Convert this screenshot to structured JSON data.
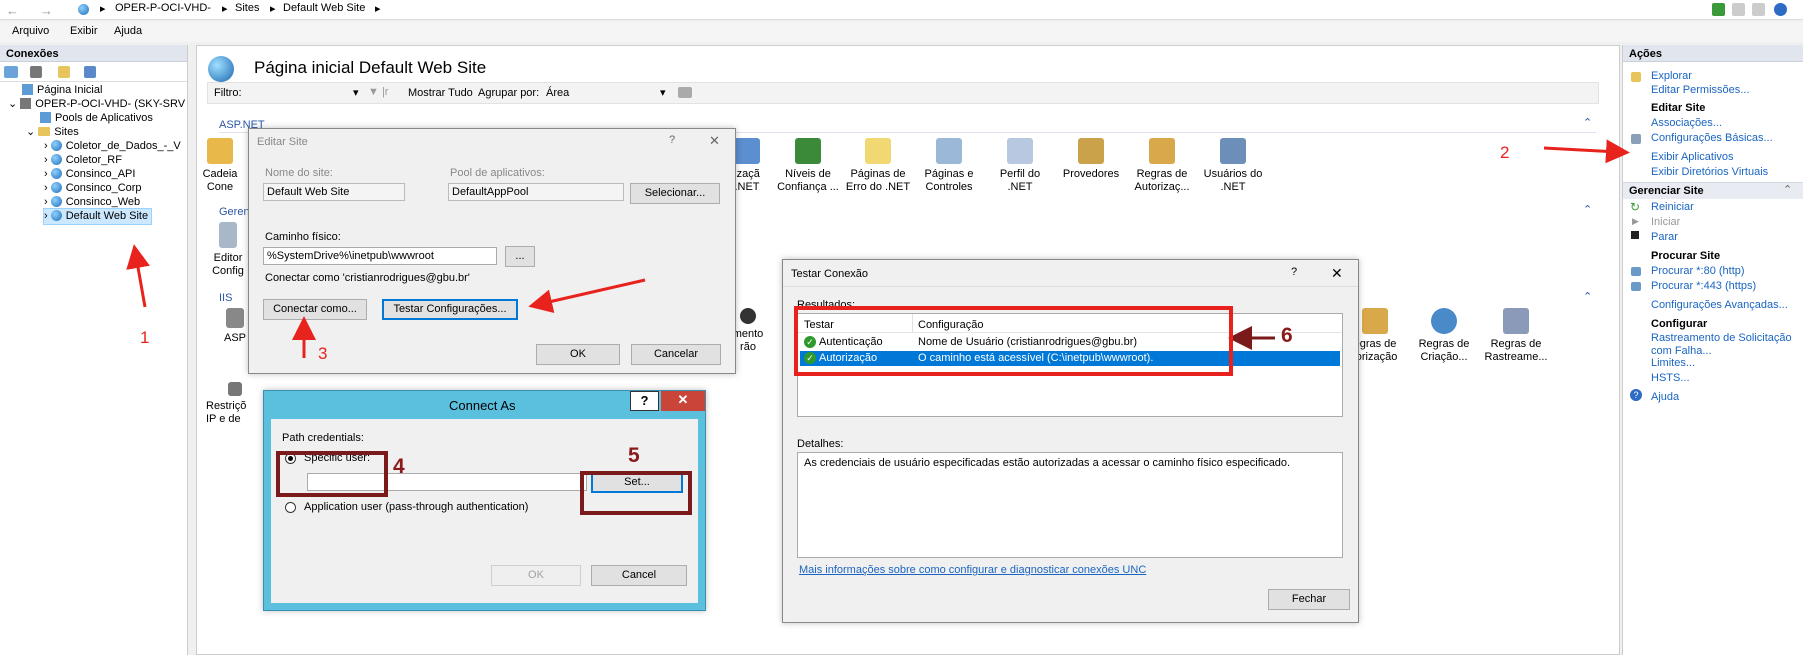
{
  "address": {
    "crumbs": [
      "OPER-P-OCI-VHD-",
      "Sites",
      "Default Web Site"
    ]
  },
  "menu": [
    "Arquivo",
    "Exibir",
    "Ajuda"
  ],
  "connections": {
    "header": "Conexões",
    "tree": [
      "Página Inicial",
      "OPER-P-OCI-VHD- (SKY-SRV",
      "Pools de Aplicativos",
      "Sites",
      "Coletor_de_Dados_-_V",
      "Coletor_RF",
      "Consinco_API",
      "Consinco_Corp",
      "Consinco_Web",
      "Default Web Site"
    ]
  },
  "main": {
    "title": "Página inicial Default Web Site",
    "filter_label": "Filtro:",
    "show_all": "Mostrar Tudo",
    "group_by_label": "Agrupar por:",
    "group_by_value": "Área",
    "groups": {
      "aspnet": "ASP.NET",
      "gerenc": "Gerenc",
      "iis": "IIS"
    },
    "aspnet_icons": [
      "Cadeia\nCone",
      "izaçã\n.NET",
      "Níveis de\nConfiança ...",
      "Páginas de\nErro do .NET",
      "Páginas e\nControles",
      "Perfil do\n.NET",
      "Provedores",
      "Regras de\nAutorizaç...",
      "Usuários do\n.NET"
    ],
    "gerenc_icons": [
      "Editor\nConfig"
    ],
    "iis_icons": [
      "ASP",
      "mento\nrão",
      "egras de\ntorização",
      "Regras de\nCriação...",
      "Regras de\nRastreame..."
    ],
    "iis_icons_row2": [
      "Restriçõ\nIP e de"
    ]
  },
  "edit_site": {
    "title": "Editar Site",
    "help": "?",
    "close": "✕",
    "site_name_label": "Nome do site:",
    "site_name": "Default Web Site",
    "pool_label": "Pool de aplicativos:",
    "pool": "DefaultAppPool",
    "select_btn": "Selecionar...",
    "path_label": "Caminho físico:",
    "path": "%SystemDrive%\\inetpub\\wwwroot",
    "browse_btn": "...",
    "connect_as_text": "Conectar como 'cristianrodrigues@gbu.br'",
    "connect_btn": "Conectar como...",
    "test_btn": "Testar Configurações...",
    "ok": "OK",
    "cancel": "Cancelar"
  },
  "connect_as": {
    "title": "Connect As",
    "help": "?",
    "close": "✕",
    "path_credentials": "Path credentials:",
    "specific_user": "Specific user:",
    "set_btn": "Set...",
    "app_user": "Application user (pass-through authentication)",
    "ok": "OK",
    "cancel": "Cancel"
  },
  "test_conn": {
    "title": "Testar Conexão",
    "help": "?",
    "close": "✕",
    "results_label": "Resultados:",
    "col_test": "Testar",
    "col_config": "Configuração",
    "rows": [
      {
        "test": "Autenticação",
        "config": "Nome de Usuário (cristianrodrigues@gbu.br)"
      },
      {
        "test": "Autorização",
        "config": "O caminho está acessível (C:\\inetpub\\wwwroot)."
      }
    ],
    "details_label": "Detalhes:",
    "details": "As credenciais de usuário especificadas estão autorizadas a acessar o caminho físico especificado.",
    "link": "Mais informações sobre como configurar e diagnosticar conexões UNC",
    "close_btn": "Fechar"
  },
  "actions": {
    "header": "Ações",
    "explorar": "Explorar",
    "editar_permissoes": "Editar Permissões...",
    "editar_site": "Editar Site",
    "associacoes": "Associações...",
    "config_basicas": "Configurações Básicas...",
    "exibir_aplicativos": "Exibir Aplicativos",
    "exibir_diretorios": "Exibir Diretórios Virtuais",
    "gerenciar_site": "Gerenciar Site",
    "reiniciar": "Reiniciar",
    "iniciar": "Iniciar",
    "parar": "Parar",
    "procurar_site": "Procurar Site",
    "procurar_80": "Procurar *:80 (http)",
    "procurar_443": "Procurar *:443 (https)",
    "config_avancadas": "Configurações Avançadas...",
    "configurar": "Configurar",
    "rastreamento": "Rastreamento de Solicitação\ncom Falha...",
    "limites": "Limites...",
    "hsts": "HSTS...",
    "ajuda": "Ajuda"
  },
  "annotations": {
    "n1": "1",
    "n2": "2",
    "n3": "3",
    "n4": "4",
    "n5": "5",
    "n6": "6"
  },
  "colors": {
    "red": "#e8231e",
    "maroon": "#7a1a1a",
    "selection": "#0078d7",
    "dialog_frame": "#5bc0de"
  }
}
